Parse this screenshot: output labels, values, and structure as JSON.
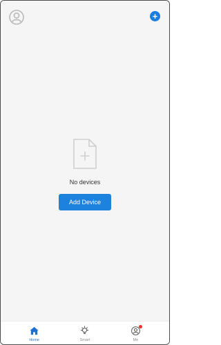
{
  "header": {
    "avatar_icon": "user-avatar-icon",
    "add_icon": "plus-circle-icon",
    "add_symbol": "+"
  },
  "empty_state": {
    "icon": "blank-document-plus-icon",
    "message": "No devices",
    "button_label": "Add Device"
  },
  "tabbar": {
    "tabs": [
      {
        "label": "Home",
        "icon": "home-icon",
        "active": true
      },
      {
        "label": "Smart",
        "icon": "bulb-icon",
        "active": false
      },
      {
        "label": "Me",
        "icon": "profile-icon",
        "active": false,
        "badge": true
      }
    ]
  },
  "colors": {
    "accent": "#1d82de",
    "background": "#f5f5f6",
    "badge": "#f0302a"
  }
}
